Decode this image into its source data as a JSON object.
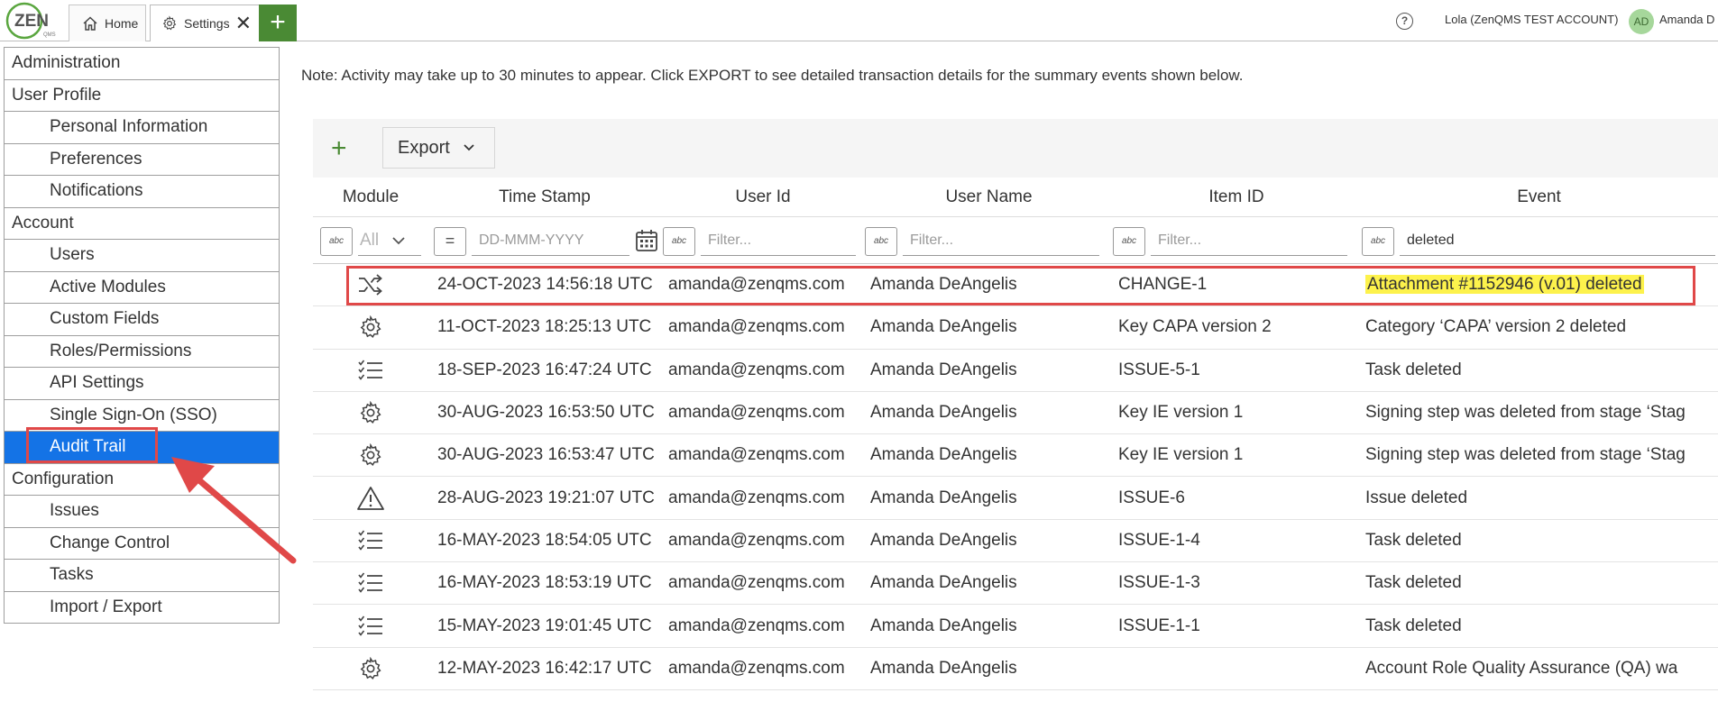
{
  "app": {
    "logo_text": "ZEN",
    "logo_sub": "QMS"
  },
  "tabs": [
    {
      "label": "Home",
      "icon": "home-icon"
    },
    {
      "label": "Settings",
      "icon": "gear-icon"
    }
  ],
  "topbar": {
    "add_tab": "+",
    "help": "?",
    "account": "Lola (ZenQMS TEST ACCOUNT)",
    "avatar_initials": "AD",
    "user_name": "Amanda D"
  },
  "sidebar": {
    "items": [
      {
        "label": "Administration",
        "kind": "section"
      },
      {
        "label": "User Profile",
        "kind": "section"
      },
      {
        "label": "Personal Information",
        "kind": "sub"
      },
      {
        "label": "Preferences",
        "kind": "sub"
      },
      {
        "label": "Notifications",
        "kind": "sub"
      },
      {
        "label": "Account",
        "kind": "section"
      },
      {
        "label": "Users",
        "kind": "sub"
      },
      {
        "label": "Active Modules",
        "kind": "sub"
      },
      {
        "label": "Custom Fields",
        "kind": "sub"
      },
      {
        "label": "Roles/Permissions",
        "kind": "sub"
      },
      {
        "label": "API Settings",
        "kind": "sub"
      },
      {
        "label": "Single Sign-On (SSO)",
        "kind": "sub"
      },
      {
        "label": "Audit Trail",
        "kind": "sub",
        "active": true
      },
      {
        "label": "Configuration",
        "kind": "section"
      },
      {
        "label": "Issues",
        "kind": "sub"
      },
      {
        "label": "Change Control",
        "kind": "sub"
      },
      {
        "label": "Tasks",
        "kind": "sub"
      },
      {
        "label": "Import / Export",
        "kind": "sub"
      }
    ]
  },
  "main": {
    "note": "Note: Activity may take up to 30 minutes to appear. Click EXPORT to see detailed transaction details for the summary events shown below.",
    "toolbar": {
      "add": "+",
      "export_label": "Export"
    },
    "columns": [
      "Module",
      "Time Stamp",
      "User Id",
      "User Name",
      "Item ID",
      "Event"
    ],
    "filters": {
      "module_value": "All",
      "timestamp_placeholder": "DD-MMM-YYYY",
      "userid_placeholder": "Filter...",
      "username_placeholder": "Filter...",
      "itemid_placeholder": "Filter...",
      "event_value": "deleted",
      "abc_icon_text": "abc"
    },
    "rows": [
      {
        "module_icon": "shuffle-icon",
        "ts": "24-OCT-2023 14:56:18 UTC",
        "uid": "amanda@zenqms.com",
        "uname": "Amanda DeAngelis",
        "item": "CHANGE-1",
        "event": "Attachment #1152946 (v.01) deleted",
        "highlight": true
      },
      {
        "module_icon": "gear-icon",
        "ts": "11-OCT-2023 18:25:13 UTC",
        "uid": "amanda@zenqms.com",
        "uname": "Amanda DeAngelis",
        "item": "Key CAPA version 2",
        "event": "Category ‘CAPA’ version 2 deleted"
      },
      {
        "module_icon": "task-list-icon",
        "ts": "18-SEP-2023 16:47:24 UTC",
        "uid": "amanda@zenqms.com",
        "uname": "Amanda DeAngelis",
        "item": "ISSUE-5-1",
        "event": "Task deleted"
      },
      {
        "module_icon": "gear-icon",
        "ts": "30-AUG-2023 16:53:50 UTC",
        "uid": "amanda@zenqms.com",
        "uname": "Amanda DeAngelis",
        "item": "Key IE version 1",
        "event": "Signing step was deleted from stage ‘Stag"
      },
      {
        "module_icon": "gear-icon",
        "ts": "30-AUG-2023 16:53:47 UTC",
        "uid": "amanda@zenqms.com",
        "uname": "Amanda DeAngelis",
        "item": "Key IE version 1",
        "event": "Signing step was deleted from stage ‘Stag"
      },
      {
        "module_icon": "warning-icon",
        "ts": "28-AUG-2023 19:21:07 UTC",
        "uid": "amanda@zenqms.com",
        "uname": "Amanda DeAngelis",
        "item": "ISSUE-6",
        "event": "Issue deleted"
      },
      {
        "module_icon": "task-list-icon",
        "ts": "16-MAY-2023 18:54:05 UTC",
        "uid": "amanda@zenqms.com",
        "uname": "Amanda DeAngelis",
        "item": "ISSUE-1-4",
        "event": "Task deleted"
      },
      {
        "module_icon": "task-list-icon",
        "ts": "16-MAY-2023 18:53:19 UTC",
        "uid": "amanda@zenqms.com",
        "uname": "Amanda DeAngelis",
        "item": "ISSUE-1-3",
        "event": "Task deleted"
      },
      {
        "module_icon": "task-list-icon",
        "ts": "15-MAY-2023 19:01:45 UTC",
        "uid": "amanda@zenqms.com",
        "uname": "Amanda DeAngelis",
        "item": "ISSUE-1-1",
        "event": "Task deleted"
      },
      {
        "module_icon": "gear-icon",
        "ts": "12-MAY-2023 16:42:17 UTC",
        "uid": "amanda@zenqms.com",
        "uname": "Amanda DeAngelis",
        "item": "",
        "event": "Account Role Quality Assurance (QA) wa"
      }
    ]
  },
  "colors": {
    "accent_green": "#4a8a34",
    "active_blue": "#1473e6",
    "annotation_red": "#e04848",
    "highlight_yellow": "#fdf24c"
  }
}
